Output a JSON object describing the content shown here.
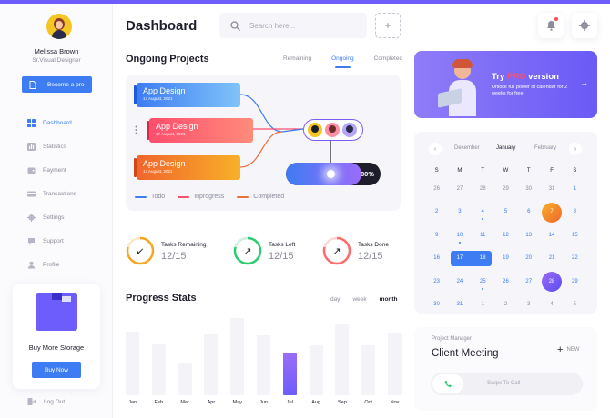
{
  "user": {
    "name": "Melissa Brown",
    "role": "Sr.Visual Designer"
  },
  "sidebar": {
    "pro_button": "Become a pro",
    "items": [
      {
        "label": "Dashboard",
        "icon": "grid-icon",
        "active": true
      },
      {
        "label": "Statistics",
        "icon": "bar-chart-icon",
        "active": false
      },
      {
        "label": "Payment",
        "icon": "wallet-icon",
        "active": false
      },
      {
        "label": "Transactions",
        "icon": "card-icon",
        "active": false
      },
      {
        "label": "Settings",
        "icon": "gear-icon",
        "active": false
      },
      {
        "label": "Support",
        "icon": "chat-icon",
        "active": false
      },
      {
        "label": "Profile",
        "icon": "user-icon",
        "active": false
      }
    ],
    "promo": {
      "title": "Buy More Storage",
      "button": "Buy Now"
    },
    "logout": "Log Out"
  },
  "header": {
    "title": "Dashboard",
    "search_placeholder": "Search here...",
    "add_label": "+"
  },
  "projects": {
    "title": "Ongoing Projects",
    "tabs": [
      {
        "label": "Remaining",
        "active": false
      },
      {
        "label": "Ongoing",
        "active": true
      },
      {
        "label": "Completed",
        "active": false
      }
    ],
    "items": [
      {
        "name": "App Design",
        "date": "17 August, 2021",
        "status": "Todo"
      },
      {
        "name": "App Design",
        "date": "17 August, 2021",
        "status": "Inprogress"
      },
      {
        "name": "App Design",
        "date": "17 August, 2021",
        "status": "Completed"
      }
    ],
    "progress": {
      "value": 80,
      "label": "80%"
    },
    "legend": [
      {
        "label": "Todo",
        "color": "#3d7cf3"
      },
      {
        "label": "Inprogress",
        "color": "#ff4d6d"
      },
      {
        "label": "Completed",
        "color": "#e8703a"
      }
    ]
  },
  "tasks": [
    {
      "label": "Tasks Remaining",
      "value": "12/15",
      "color": "#f5a623",
      "arrow": "↙"
    },
    {
      "label": "Tasks Left",
      "value": "12/15",
      "color": "#2ecc71",
      "arrow": "↗"
    },
    {
      "label": "Tasks Done",
      "value": "12/15",
      "color": "#ff6b6b",
      "arrow": "↗"
    }
  ],
  "progress_stats": {
    "title": "Progress Stats",
    "tabs": [
      {
        "label": "day",
        "active": false
      },
      {
        "label": "week",
        "active": false
      },
      {
        "label": "month",
        "active": true
      }
    ]
  },
  "chart_data": {
    "type": "bar",
    "categories": [
      "Jan",
      "Feb",
      "Mar",
      "Apr",
      "May",
      "Jun",
      "Jul",
      "Aug",
      "Sep",
      "Oct",
      "Nov"
    ],
    "values": [
      74,
      59,
      37,
      71,
      90,
      70,
      49,
      58,
      82,
      58,
      72
    ],
    "highlight": "Jul",
    "ylim": [
      0,
      100
    ]
  },
  "banner": {
    "title_prefix": "Try ",
    "title_pro": "PRO",
    "title_suffix": " version",
    "description": "Unlock full power of calendar for 2 weeks for free!",
    "arrow": "→"
  },
  "calendar": {
    "prev_month": "December",
    "current_month": "January",
    "next_month": "February",
    "weekdays": [
      "S",
      "M",
      "T",
      "W",
      "T",
      "F",
      "S"
    ],
    "weeks": [
      [
        {
          "d": "26",
          "m": true
        },
        {
          "d": "27",
          "m": true
        },
        {
          "d": "28",
          "m": true
        },
        {
          "d": "29",
          "m": true
        },
        {
          "d": "30",
          "m": true
        },
        {
          "d": "31",
          "m": true
        },
        {
          "d": "1"
        }
      ],
      [
        {
          "d": "2"
        },
        {
          "d": "3"
        },
        {
          "d": "4",
          "dot": true
        },
        {
          "d": "5"
        },
        {
          "d": "6"
        },
        {
          "d": "7",
          "orange": true
        },
        {
          "d": "8"
        }
      ],
      [
        {
          "d": "9"
        },
        {
          "d": "10",
          "dot": true
        },
        {
          "d": "11"
        },
        {
          "d": "12"
        },
        {
          "d": "13"
        },
        {
          "d": "14"
        },
        {
          "d": "15"
        }
      ],
      [
        {
          "d": "16"
        },
        {
          "d": "17",
          "selL": true
        },
        {
          "d": "18",
          "selR": true
        },
        {
          "d": "19"
        },
        {
          "d": "20"
        },
        {
          "d": "21"
        },
        {
          "d": "22"
        }
      ],
      [
        {
          "d": "23"
        },
        {
          "d": "24"
        },
        {
          "d": "25",
          "dot": true
        },
        {
          "d": "26"
        },
        {
          "d": "27"
        },
        {
          "d": "28",
          "purple": true
        },
        {
          "d": "29"
        }
      ],
      [
        {
          "d": "30"
        },
        {
          "d": "31"
        },
        {
          "d": "1",
          "m": true
        },
        {
          "d": "2",
          "m": true
        },
        {
          "d": "3",
          "m": true
        },
        {
          "d": "4",
          "m": true
        },
        {
          "d": "5",
          "m": true
        }
      ]
    ]
  },
  "meeting": {
    "role": "Project Manager",
    "title": "Client Meeting",
    "new_label": "NEW",
    "swipe_label": "Swipe To Call"
  },
  "colors": {
    "accent": "#3d7cf3",
    "purple": "#6d5dfc",
    "dark": "#1d1d2c"
  }
}
